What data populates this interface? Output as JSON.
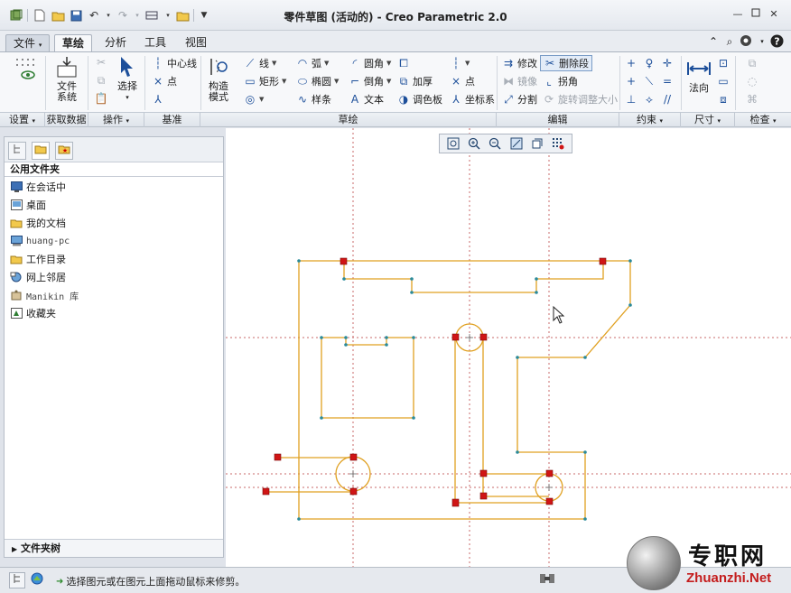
{
  "window": {
    "title": "零件草图 (活动的) - Creo Parametric 2.0"
  },
  "tabs": [
    {
      "label": "文件"
    },
    {
      "label": "草绘"
    },
    {
      "label": "分析"
    },
    {
      "label": "工具"
    },
    {
      "label": "视图"
    }
  ],
  "ribbon": {
    "setup": {
      "coord_label": "文件\n系统"
    },
    "file_system": "文件\n系统",
    "select": "选择",
    "centerline": "中心线",
    "point": "点",
    "construction_mode": "构造\n模式",
    "line": "线",
    "arc": "弧",
    "fillet": "圆角",
    "rectangle": "矩形",
    "ellipse": "椭圆",
    "chamfer": "倒角",
    "thicken": "加厚",
    "sketch_point": "点",
    "spline": "样条",
    "text": "文本",
    "palette": "调色板",
    "coord_system": "坐标系",
    "modify": "修改",
    "delete_segment": "删除段",
    "mirror": "镜像",
    "corner": "拐角",
    "divide": "分割",
    "rotate_resize": "旋转调整大小",
    "normal": "法向"
  },
  "groups": {
    "settings": "设置",
    "get_data": "获取数据",
    "operations": "操作",
    "datum": "基准",
    "sketching": "草绘",
    "editing": "编辑",
    "constraints": "约束",
    "dimension": "尺寸",
    "inspect": "检查"
  },
  "left_panel": {
    "header": "公用文件夹",
    "items": [
      {
        "label": "在会话中",
        "icon": "monitor-icon"
      },
      {
        "label": "桌面",
        "icon": "desktop-icon"
      },
      {
        "label": "我的文档",
        "icon": "folder-icon"
      },
      {
        "label": "huang-pc",
        "icon": "computer-icon"
      },
      {
        "label": "工作目录",
        "icon": "folder-icon"
      },
      {
        "label": "网上邻居",
        "icon": "network-icon"
      },
      {
        "label": "Manikin 库",
        "icon": "manikin-icon"
      },
      {
        "label": "收藏夹",
        "icon": "favorites-icon"
      }
    ],
    "footer": "文件夹树"
  },
  "status": {
    "message": "选择图元或在图元上面拖动鼠标来修剪。"
  },
  "watermark": {
    "cn": "专职网",
    "en": "Zhuanzhi.Net"
  },
  "colors": {
    "sketch_line": "#e0a020",
    "vertex": "#2a8a9a",
    "constraint": "#d01515",
    "reference": "#c86a6a"
  }
}
